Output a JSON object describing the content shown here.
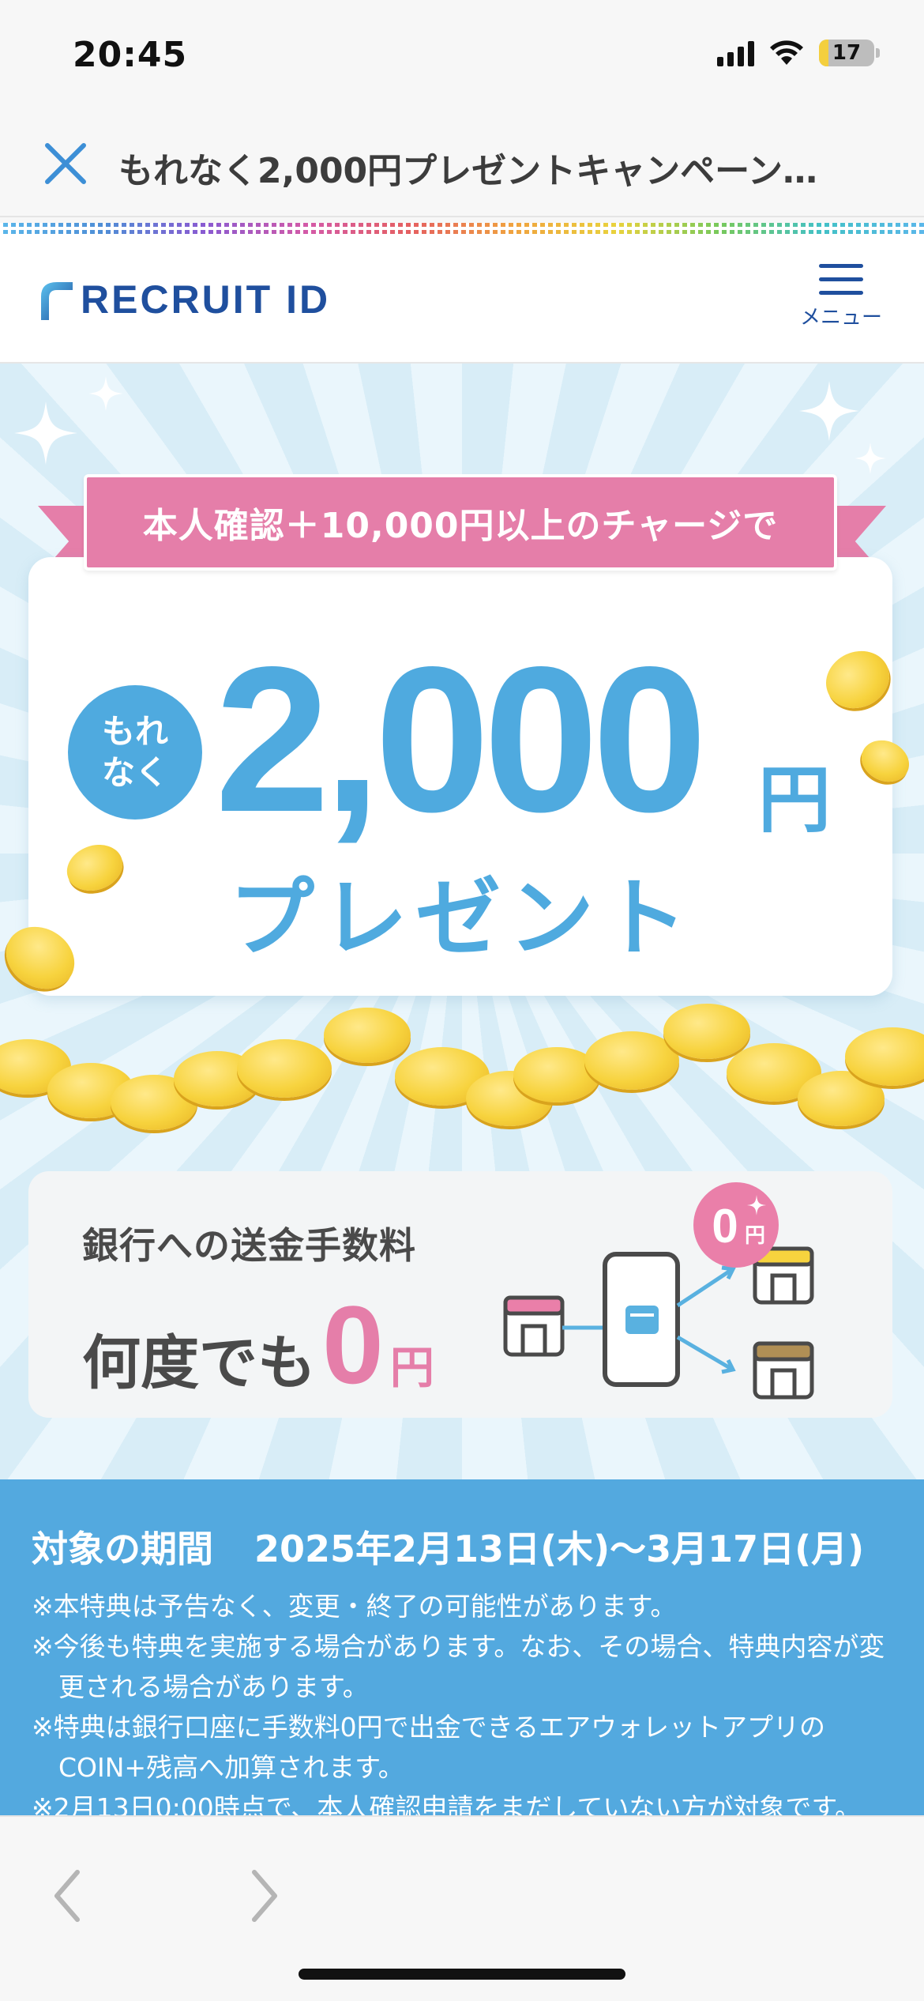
{
  "status_bar": {
    "time": "20:45",
    "battery_level": "17",
    "battery_fraction": 0.17,
    "icons": [
      "signal-icon",
      "wifi-icon",
      "battery-icon"
    ]
  },
  "browser": {
    "close_icon": "close-icon",
    "title": "もれなく2,000円プレゼントキャンペーン…"
  },
  "site_header": {
    "logo_text": "RECRUIT ID",
    "menu_label": "メニュー"
  },
  "hero": {
    "ribbon_text": "本人確認＋10,000円以上のチャージで",
    "badge_line1": "もれ",
    "badge_line2": "なく",
    "amount": "2,000",
    "amount_unit": "円",
    "present": "プレゼント"
  },
  "fee_card": {
    "line1": "銀行への送金手数料",
    "line2_prefix": "何度でも",
    "zero": "0",
    "yen": "円",
    "illus_badge_zero": "0",
    "illus_badge_yen": "円"
  },
  "period": {
    "label": "対象の期間",
    "dates": "2025年2月13日(木)～3月17日(月)",
    "notes": [
      "※本特典は予告なく、変更・終了の可能性があります。",
      "※今後も特典を実施する場合があります。なお、その場合、特典内容が変更される場合があります。",
      "※特典は銀行口座に手数料0円で出金できるエアウォレットアプリのCOIN+残高へ加算されます。",
      "※2月13日0:00時点で、本人確認申請をまだしていない方が対象です。"
    ]
  },
  "toolbar": {
    "back_icon": "chevron-left-icon",
    "forward_icon": "chevron-right-icon"
  },
  "colors": {
    "accent_blue": "#4faadf",
    "accent_pink": "#e57ea9",
    "brand_navy": "#1f4f9e",
    "coin_gold": "#f7d33e"
  }
}
